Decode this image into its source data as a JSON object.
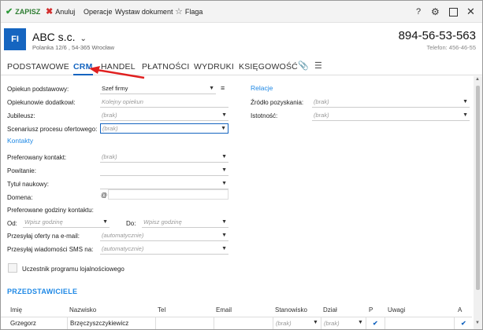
{
  "toolbar": {
    "save_label": "ZAPISZ",
    "cancel_label": "Anuluj",
    "operations_label": "Operacje",
    "issue_document_label": "Wystaw dokument",
    "flag_label": "Flaga",
    "help_label": "?"
  },
  "header": {
    "avatar_initials": "FI",
    "company_name": "ABC s.c.",
    "address": "Polanka  12/6 , 54-365 Wrocław",
    "phone": "894-56-53-563",
    "phone_secondary": "Telefon: 456-46-55"
  },
  "tabs": [
    {
      "label": "PODSTAWOWE"
    },
    {
      "label": "CRM"
    },
    {
      "label": "HANDEL"
    },
    {
      "label": "PŁATNOŚCI"
    },
    {
      "label": "WYDRUKI"
    },
    {
      "label": "KSIĘGOWOŚĆ"
    }
  ],
  "form": {
    "main_guardian": {
      "label": "Opiekun podstawowy:",
      "value": "Szef firmy"
    },
    "additional_guardians": {
      "label": "Opiekunowie dodatkowi:",
      "placeholder": "Kolejny opiekun"
    },
    "jubilee": {
      "label": "Jubileusz:",
      "placeholder": "(brak)"
    },
    "offer_scenario": {
      "label": "Scenariusz procesu ofertowego:",
      "placeholder": "(brak)"
    },
    "contacts_section": "Kontakty",
    "preferred_contact": {
      "label": "Preferowany kontakt:",
      "placeholder": "(brak)"
    },
    "greeting": {
      "label": "Powitanie:"
    },
    "academic_title": {
      "label": "Tytuł naukowy:"
    },
    "domain": {
      "label": "Domena:",
      "prefix": "@"
    },
    "preferred_hours_label": "Preferowane godziny kontaktu:",
    "from": {
      "label": "Od:",
      "placeholder": "Wpisz godzinę"
    },
    "to": {
      "label": "Do:",
      "placeholder": "Wpisz godzinę"
    },
    "send_offers_email": {
      "label": "Przesyłaj oferty na e-mail:",
      "placeholder": "(automatycznie)"
    },
    "send_sms": {
      "label": "Przesyłaj wiadomości SMS na:",
      "placeholder": "(automatycznie)"
    },
    "loyalty_program_label": "Uczestnik programu lojalnościowego"
  },
  "relations": {
    "section": "Relacje",
    "acquisition_source": {
      "label": "Źródło pozyskania:",
      "placeholder": "(brak)"
    },
    "importance": {
      "label": "Istotność:",
      "placeholder": "(brak)"
    }
  },
  "representatives": {
    "section": "PRZEDSTAWICIELE",
    "columns": [
      "Imię",
      "Nazwisko",
      "Tel",
      "Email",
      "Stanowisko",
      "Dział",
      "P",
      "Uwagi",
      "A"
    ],
    "rows": [
      {
        "first_name": "Grzegorz",
        "last_name": "Brzęczyszczykiewicz",
        "tel": "",
        "email": "",
        "position": "(brak)",
        "department": "(brak)",
        "p": true,
        "notes": "",
        "a": true
      }
    ]
  },
  "colors": {
    "accent": "#1565c0",
    "save_green": "#2e9a3a",
    "cancel_red": "#d32f2f",
    "arrow_red": "#e02020"
  }
}
